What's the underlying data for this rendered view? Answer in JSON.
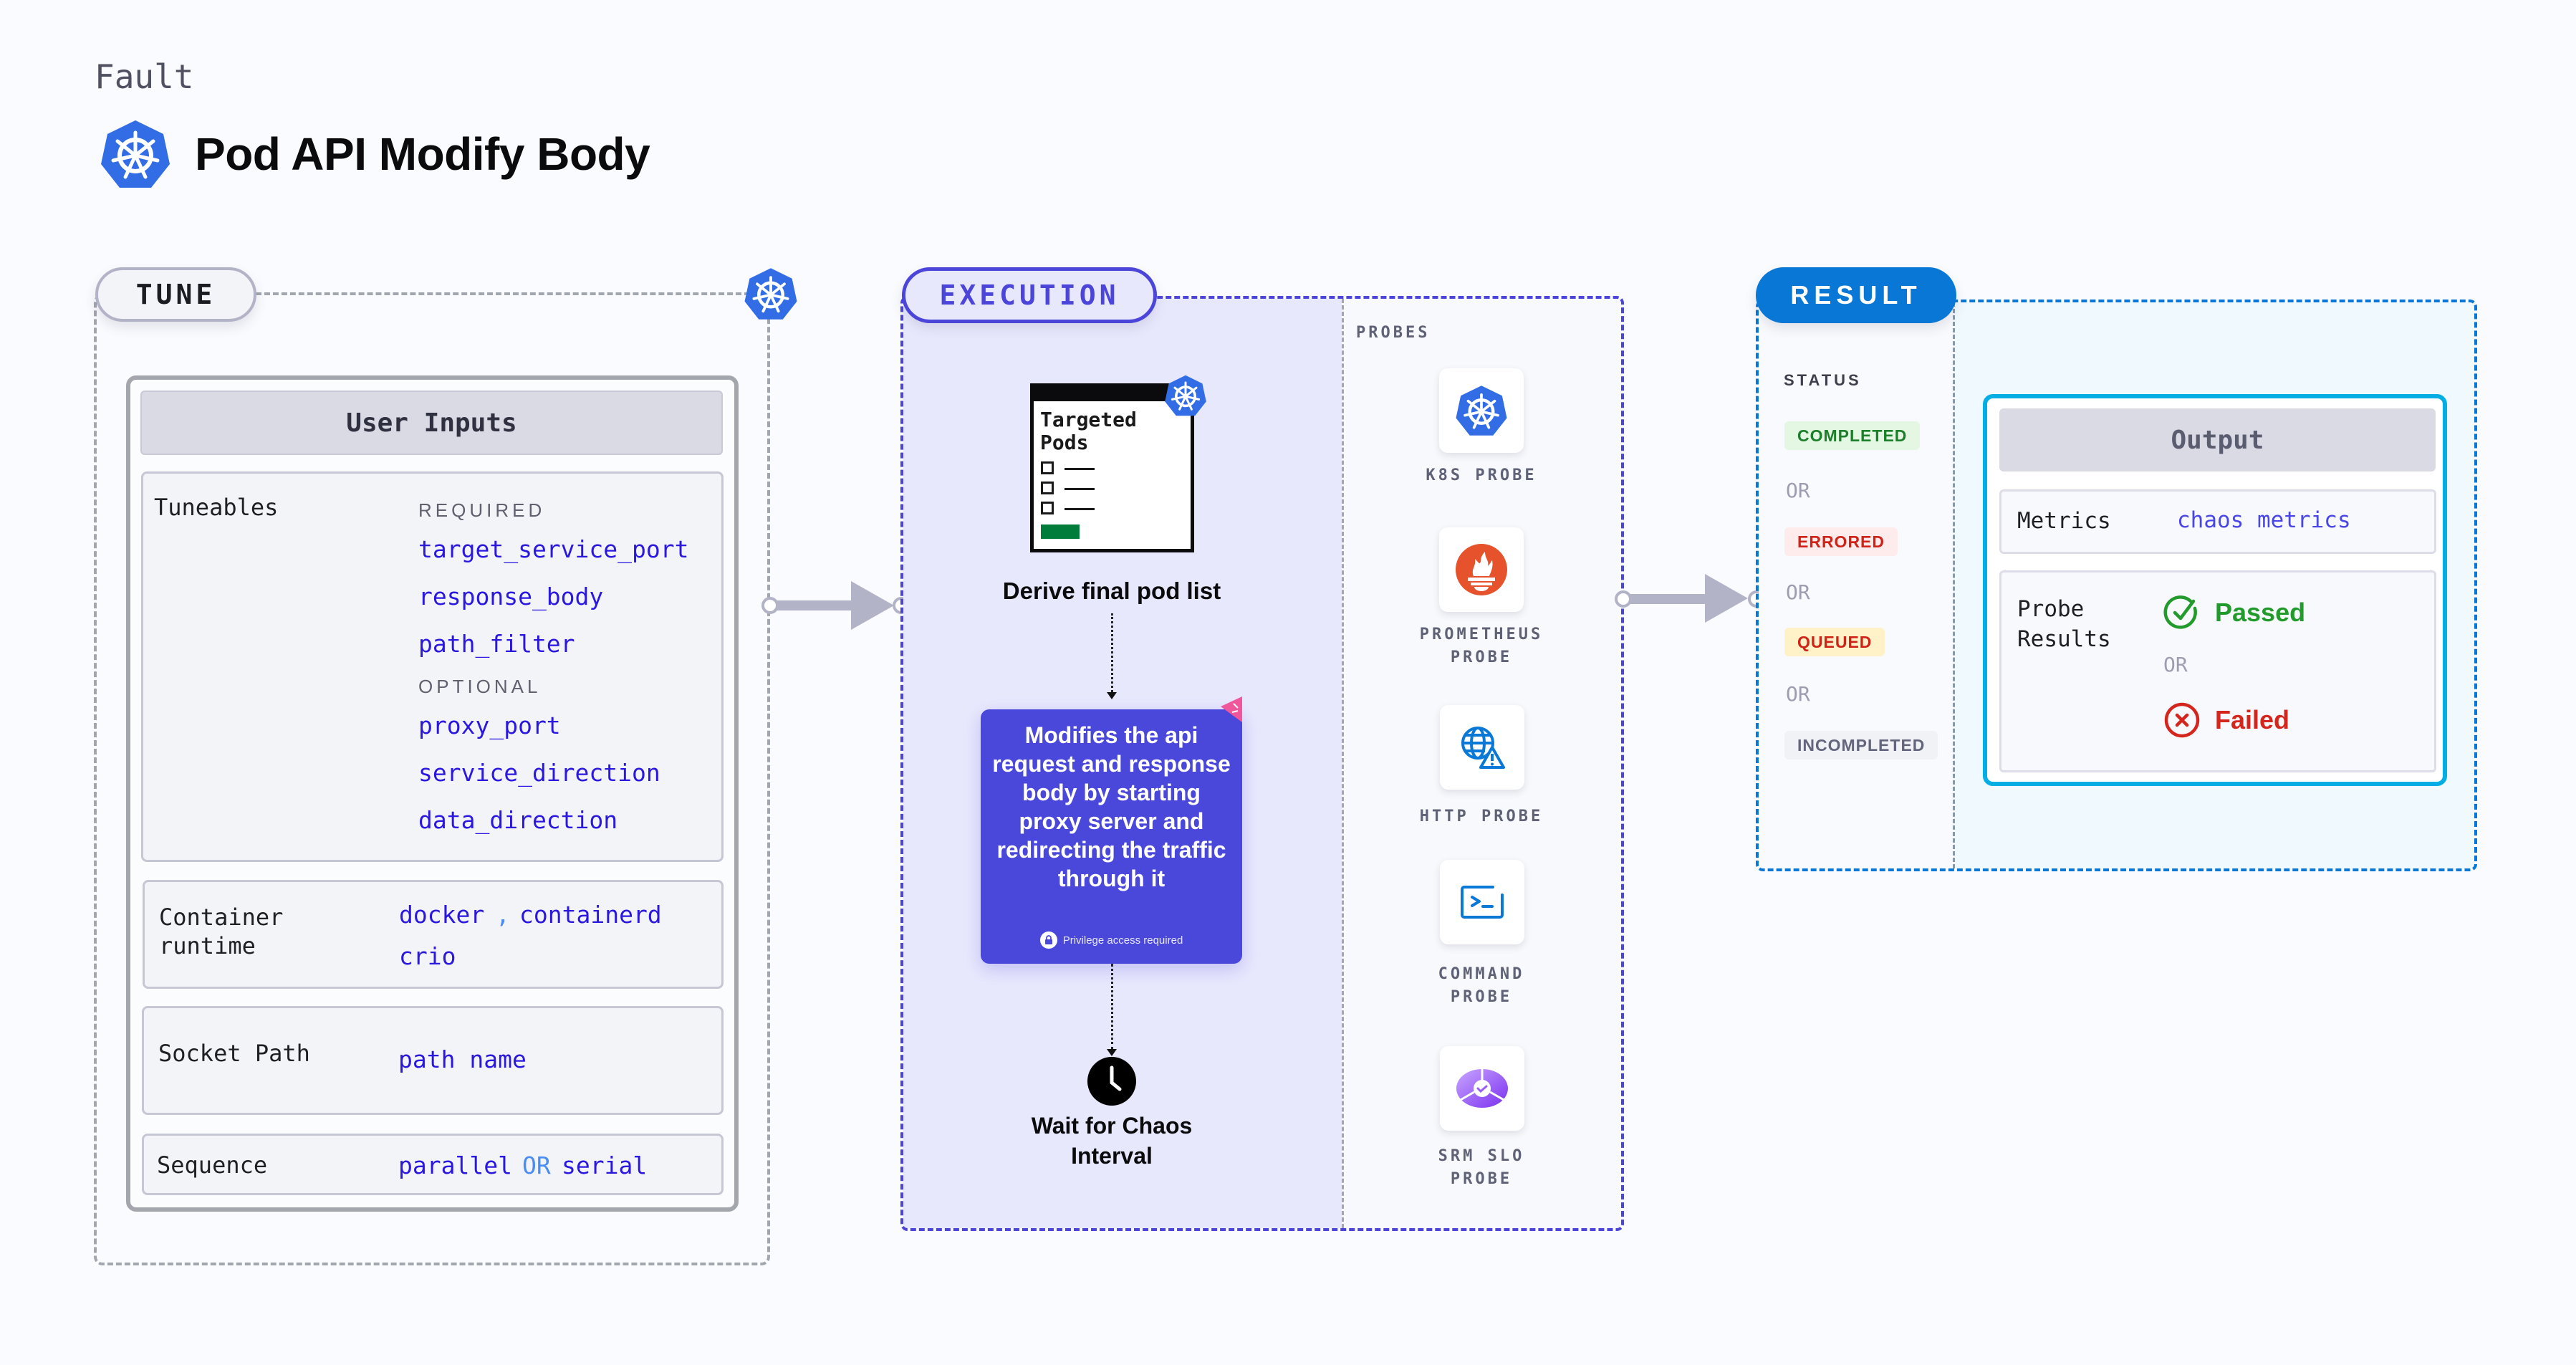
{
  "header": {
    "category": "Fault",
    "title": "Pod API Modify Body",
    "logo_icon": "kubernetes-icon"
  },
  "tune": {
    "label": "TUNE",
    "corner_icon": "kubernetes-icon",
    "user_inputs": {
      "title": "User Inputs",
      "tuneables": {
        "label": "Tuneables",
        "required_label": "REQUIRED",
        "required": [
          "target_service_port",
          "response_body",
          "path_filter"
        ],
        "optional_label": "OPTIONAL",
        "optional": [
          "proxy_port",
          "service_direction",
          "data_direction"
        ]
      },
      "container_runtime": {
        "label_line1": "Container",
        "label_line2": "runtime",
        "values": [
          "docker",
          "containerd",
          "crio"
        ],
        "separator": ","
      },
      "socket_path": {
        "label": "Socket Path",
        "value": "path name"
      },
      "sequence": {
        "label": "Sequence",
        "value_a": "parallel",
        "or": "OR",
        "value_b": "serial"
      }
    }
  },
  "execution": {
    "label": "EXECUTION",
    "steps": {
      "pods_card_title_line1": "Targeted",
      "pods_card_title_line2": "Pods",
      "derive": "Derive final pod list",
      "fault_description": "Modifies the api request and response body by starting proxy server and redirecting the traffic through it",
      "privilege_note": "Privilege access required",
      "wait_line1": "Wait for Chaos",
      "wait_line2": "Interval"
    },
    "probes": {
      "title": "PROBES",
      "items": [
        {
          "label_line1": "K8S PROBE",
          "label_line2": "",
          "icon": "kubernetes-icon"
        },
        {
          "label_line1": "PROMETHEUS",
          "label_line2": "PROBE",
          "icon": "prometheus-icon"
        },
        {
          "label_line1": "HTTP PROBE",
          "label_line2": "",
          "icon": "globe-warning-icon"
        },
        {
          "label_line1": "COMMAND",
          "label_line2": "PROBE",
          "icon": "terminal-icon"
        },
        {
          "label_line1": "SRM SLO",
          "label_line2": "PROBE",
          "icon": "slo-gauge-icon"
        }
      ]
    }
  },
  "result": {
    "label": "RESULT",
    "status_title": "STATUS",
    "or": "OR",
    "statuses": [
      {
        "label": "COMPLETED",
        "fg": "#1c7f2a",
        "bg": "#e3f7e3"
      },
      {
        "label": "ERRORED",
        "fg": "#cf2318",
        "bg": "#fdeceb"
      },
      {
        "label": "QUEUED",
        "fg": "#cf2318",
        "bg": "#fff1c8"
      },
      {
        "label": "INCOMPLETED",
        "fg": "#62657b",
        "bg": "#f1f2f6"
      }
    ],
    "output": {
      "title": "Output",
      "metrics_label": "Metrics",
      "metrics_value": "chaos metrics",
      "probe_results_line1": "Probe",
      "probe_results_line2": "Results",
      "passed": "Passed",
      "failed": "Failed",
      "or": "OR"
    }
  },
  "colors": {
    "k8s_blue": "#326de6",
    "execution_accent": "#4b45da",
    "result_accent": "#0877d5",
    "param_text": "#2a18e0",
    "passed": "#239b2c",
    "failed": "#d4261c"
  }
}
